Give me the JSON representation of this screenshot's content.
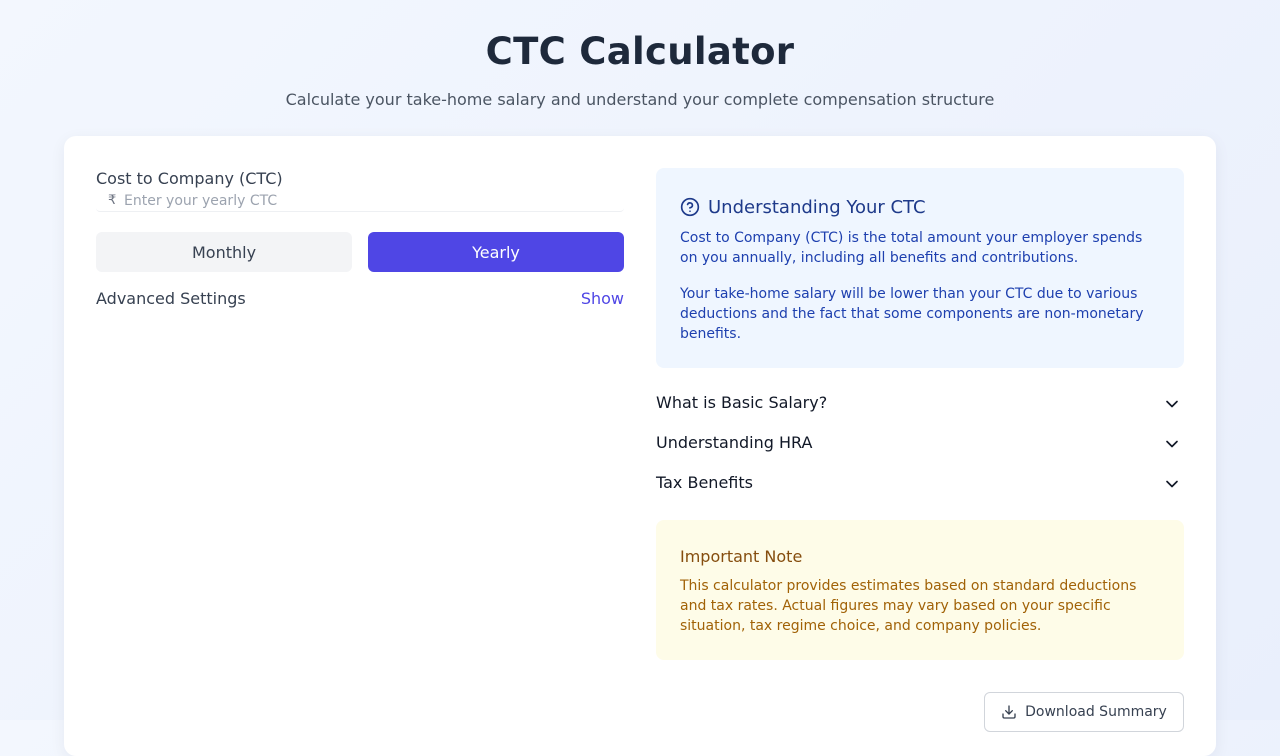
{
  "header": {
    "title": "CTC Calculator",
    "subtitle": "Calculate your take-home salary and understand your complete compensation structure"
  },
  "calculator": {
    "ctc_label": "Cost to Company (CTC)",
    "currency_symbol": "₹",
    "ctc_input_value": "",
    "ctc_placeholder": "Enter your yearly CTC",
    "period_options": [
      "Monthly",
      "Yearly"
    ],
    "selected_period": "Yearly",
    "advanced_settings_label": "Advanced Settings",
    "advanced_toggle_label": "Show"
  },
  "info": {
    "icon": "question-circle-icon",
    "title": "Understanding Your CTC",
    "paragraph1": "Cost to Company (CTC) is the total amount your employer spends on you annually, including all benefits and contributions.",
    "paragraph2": "Your take-home salary will be lower than your CTC due to various deductions and the fact that some components are non-monetary benefits."
  },
  "faq": [
    {
      "label": "What is Basic Salary?",
      "icon": "chevron-down-icon"
    },
    {
      "label": "Understanding HRA",
      "icon": "chevron-down-icon"
    },
    {
      "label": "Tax Benefits",
      "icon": "chevron-down-icon"
    }
  ],
  "note": {
    "title": "Important Note",
    "text": "This calculator provides estimates based on standard deductions and tax rates. Actual figures may vary based on your specific situation, tax regime choice, and company policies."
  },
  "actions": {
    "download_label": "Download Summary",
    "download_icon": "download-icon"
  },
  "colors": {
    "accent": "#4f46e5",
    "info_bg": "#eff6ff",
    "info_text": "#1e40af",
    "note_bg": "#fefce8",
    "note_text": "#a16207"
  }
}
